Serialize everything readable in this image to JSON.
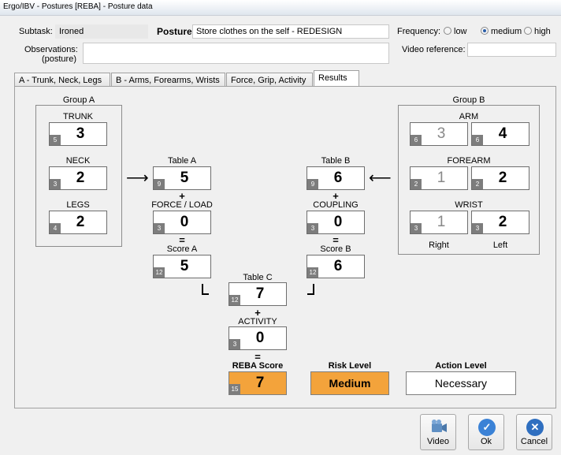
{
  "window": {
    "title": "Ergo/IBV - Postures [REBA] - Posture data"
  },
  "header": {
    "subtask_label": "Subtask:",
    "subtask_value": "Ironed",
    "posture_label": "Posture:",
    "posture_value": "Store clothes on the self - REDESIGN",
    "frequency_label": "Frequency:",
    "frequency_options": [
      "low",
      "medium",
      "high"
    ],
    "frequency_selected": "medium",
    "observations_label_1": "Observations:",
    "observations_label_2": "(posture)",
    "observations_value": "",
    "video_reference_label": "Video reference:",
    "video_reference_value": ""
  },
  "tabs": [
    {
      "label": "A - Trunk, Neck, Legs"
    },
    {
      "label": "B - Arms, Forearms, Wrists"
    },
    {
      "label": "Force, Grip, Activity"
    },
    {
      "label": "Results",
      "active": true
    }
  ],
  "group_a": {
    "title": "Group A",
    "trunk": {
      "label": "TRUNK",
      "max": "5",
      "value": "3"
    },
    "neck": {
      "label": "NECK",
      "max": "3",
      "value": "2"
    },
    "legs": {
      "label": "LEGS",
      "max": "4",
      "value": "2"
    }
  },
  "group_b": {
    "title": "Group B",
    "arm": {
      "label": "ARM",
      "right_max": "6",
      "right_value": "3",
      "left_max": "6",
      "left_value": "4"
    },
    "forearm": {
      "label": "FOREARM",
      "right_max": "2",
      "right_value": "1",
      "left_max": "2",
      "left_value": "2"
    },
    "wrist": {
      "label": "WRIST",
      "right_max": "3",
      "right_value": "1",
      "left_max": "3",
      "left_value": "2"
    },
    "right_label": "Right",
    "left_label": "Left"
  },
  "calc_a": {
    "table_label": "Table A",
    "table_max": "9",
    "table_value": "5",
    "plus": "+",
    "force_label": "FORCE / LOAD",
    "force_max": "3",
    "force_value": "0",
    "equals": "=",
    "score_label": "Score A",
    "score_max": "12",
    "score_value": "5"
  },
  "calc_b": {
    "table_label": "Table B",
    "table_max": "9",
    "table_value": "6",
    "plus": "+",
    "coupling_label": "COUPLING",
    "coupling_max": "3",
    "coupling_value": "0",
    "equals": "=",
    "score_label": "Score B",
    "score_max": "12",
    "score_value": "6"
  },
  "calc_c": {
    "table_label": "Table C",
    "table_max": "12",
    "table_value": "7",
    "plus": "+",
    "activity_label": "ACTIVITY",
    "activity_max": "3",
    "activity_value": "0",
    "equals": "="
  },
  "result": {
    "reba_label": "REBA Score",
    "reba_max": "15",
    "reba_value": "7",
    "risk_label": "Risk Level",
    "risk_value": "Medium",
    "action_label": "Action Level",
    "action_value": "Necessary"
  },
  "buttons": {
    "video": "Video",
    "ok": "Ok",
    "cancel": "Cancel"
  },
  "colors": {
    "orange": "#f3a33b",
    "ok_blue": "#3b82d6",
    "cancel_blue": "#2f6fc0"
  }
}
